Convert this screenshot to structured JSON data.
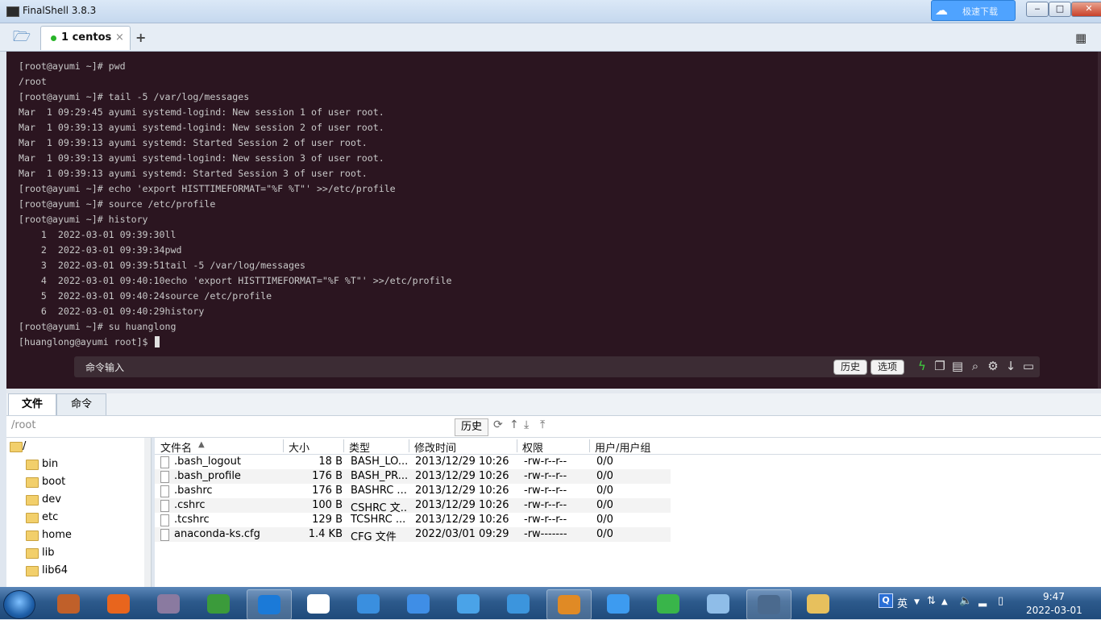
{
  "window": {
    "title": "FinalShell 3.8.3"
  },
  "tabs": [
    {
      "label": "1 centos",
      "close": "×",
      "status_color": "#28b428"
    }
  ],
  "tabbar": {
    "add": "+"
  },
  "cloud_badge": {
    "text": "极速下载"
  },
  "terminal": {
    "lines": [
      "[root@ayumi ~]# pwd",
      "/root",
      "[root@ayumi ~]# tail -5 /var/log/messages",
      "Mar  1 09:29:45 ayumi systemd-logind: New session 1 of user root.",
      "Mar  1 09:39:13 ayumi systemd-logind: New session 2 of user root.",
      "Mar  1 09:39:13 ayumi systemd: Started Session 2 of user root.",
      "Mar  1 09:39:13 ayumi systemd-logind: New session 3 of user root.",
      "Mar  1 09:39:13 ayumi systemd: Started Session 3 of user root.",
      "[root@ayumi ~]# echo 'export HISTTIMEFORMAT=\"%F %T\"' >>/etc/profile",
      "[root@ayumi ~]# source /etc/profile",
      "[root@ayumi ~]# history",
      "    1  2022-03-01 09:39:30ll",
      "    2  2022-03-01 09:39:34pwd",
      "    3  2022-03-01 09:39:51tail -5 /var/log/messages",
      "    4  2022-03-01 09:40:10echo 'export HISTTIMEFORMAT=\"%F %T\"' >>/etc/profile",
      "    5  2022-03-01 09:40:24source /etc/profile",
      "    6  2022-03-01 09:40:29history",
      "[root@ayumi ~]# su huanglong",
      "[huanglong@ayumi root]$ "
    ],
    "command_bar": {
      "label": "命令输入",
      "history_button": "历史",
      "options_button": "选项"
    }
  },
  "lower_tabs": [
    "文件",
    "命令"
  ],
  "pathbar": {
    "path": "/root",
    "history_button": "历史"
  },
  "tree": [
    "/",
    "bin",
    "boot",
    "dev",
    "etc",
    "home",
    "lib",
    "lib64"
  ],
  "file_table": {
    "headers": [
      "文件名",
      "大小",
      "类型",
      "修改时间",
      "权限",
      "用户/用户组"
    ],
    "rows": [
      [
        ".bash_logout",
        "18 B",
        "BASH_LO...",
        "2013/12/29 10:26",
        "-rw-r--r--",
        "0/0"
      ],
      [
        ".bash_profile",
        "176 B",
        "BASH_PR...",
        "2013/12/29 10:26",
        "-rw-r--r--",
        "0/0"
      ],
      [
        ".bashrc",
        "176 B",
        "BASHRC ...",
        "2013/12/29 10:26",
        "-rw-r--r--",
        "0/0"
      ],
      [
        ".cshrc",
        "100 B",
        "CSHRC 文...",
        "2013/12/29 10:26",
        "-rw-r--r--",
        "0/0"
      ],
      [
        ".tcshrc",
        "129 B",
        "TCSHRC ...",
        "2013/12/29 10:26",
        "-rw-r--r--",
        "0/0"
      ],
      [
        "anaconda-ks.cfg",
        "1.4 KB",
        "CFG 文件",
        "2022/03/01 09:29",
        "-rw-------",
        "0/0"
      ]
    ]
  },
  "taskbar": {
    "ime": "英",
    "time": "9:47",
    "date": "2022-03-01",
    "apps": [
      {
        "name": "chrome-canary",
        "color": "#c0602a"
      },
      {
        "name": "firefox",
        "color": "#e8651d"
      },
      {
        "name": "dvd",
        "color": "#8a7aa0"
      },
      {
        "name": "chrome",
        "color": "#3b9b3b"
      },
      {
        "name": "qq-browser",
        "color": "#1b7ad8"
      },
      {
        "name": "youku",
        "color": "#ffffff"
      },
      {
        "name": "pp-assistant",
        "color": "#3a8fdf"
      },
      {
        "name": "feishu",
        "color": "#3f8ee6"
      },
      {
        "name": "chat-1",
        "color": "#4aa3e8"
      },
      {
        "name": "chat-2",
        "color": "#3c95dd"
      },
      {
        "name": "vmware",
        "color": "#e08a25"
      },
      {
        "name": "baidu-netdisk",
        "color": "#3d9bf0"
      },
      {
        "name": "wechat",
        "color": "#39b54a"
      },
      {
        "name": "notepad",
        "color": "#8fbde8"
      },
      {
        "name": "remote-desktop",
        "color": "#4b6a8e"
      },
      {
        "name": "explorer",
        "color": "#e7c05d"
      }
    ]
  }
}
